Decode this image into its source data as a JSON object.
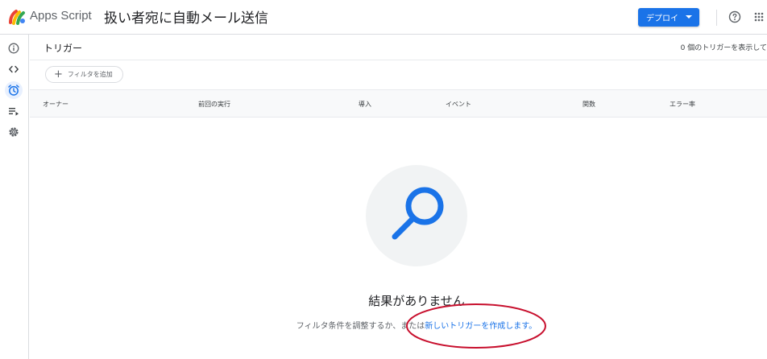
{
  "header": {
    "app_name": "Apps Script",
    "project_title": "扱い者宛に自動メール送信",
    "deploy_label": "デプロイ",
    "logo_icon": "apps-script-logo",
    "help_icon": "help-circle-icon",
    "apps_icon": "apps-grid-icon",
    "accent_color": "#1a73e8"
  },
  "sidebar": {
    "items": [
      {
        "icon": "info-icon",
        "label": "概要"
      },
      {
        "icon": "code-icon",
        "label": "エディタ"
      },
      {
        "icon": "alarm-clock-icon",
        "label": "トリガー",
        "active": true
      },
      {
        "icon": "executions-icon",
        "label": "実行数"
      },
      {
        "icon": "settings-icon",
        "label": "プロジェクトの設定"
      }
    ]
  },
  "main": {
    "title": "トリガー",
    "count_text": "0 個のトリガーを表示して",
    "filter_label": "フィルタを追加",
    "columns": [
      "オーナー",
      "前回の実行",
      "導入",
      "イベント",
      "関数",
      "エラー率"
    ],
    "empty_state": {
      "title": "結果がありません",
      "text_before": "フィルタ条件を調整するか、または",
      "link_text": "新しいトリガーを作成します。",
      "illustration_icon": "search-magnifier-icon"
    }
  }
}
